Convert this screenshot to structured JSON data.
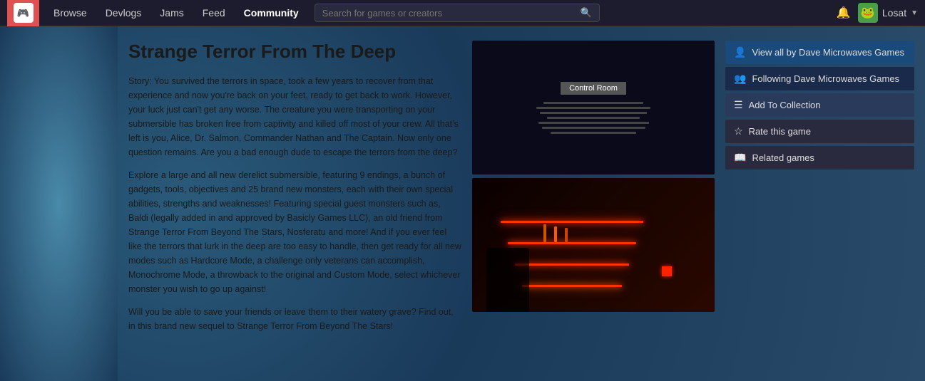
{
  "header": {
    "logo_emoji": "🎮",
    "nav": [
      {
        "label": "Browse",
        "active": false
      },
      {
        "label": "Devlogs",
        "active": false
      },
      {
        "label": "Jams",
        "active": false
      },
      {
        "label": "Feed",
        "active": false
      },
      {
        "label": "Community",
        "active": true
      }
    ],
    "search_placeholder": "Search for games or creators",
    "username": "Losat",
    "avatar_emoji": "🐸"
  },
  "game": {
    "title": "Strange Terror From The Deep",
    "description_1": "Story: You survived the terrors in space, took a few years to recover from that experience and now you're back on your feet, ready to get back to work. However, your luck just can't get any worse. The creature you were transporting on your submersible has broken free from captivity and killed off most of your crew. All that's left is you, Alice, Dr. Salmon, Commander Nathan and The Captain. Now only one question remains. Are you a bad enough dude to escape the terrors from the deep?",
    "description_2": "Explore a large and all new derelict submersible, featuring 9 endings, a bunch of gadgets, tools, objectives and 25 brand new monsters, each with their own special abilities, strengths and weaknesses! Featuring special guest monsters such as, Baldi (legally added in and approved by Basicly Games LLC), an old friend from Strange Terror From Beyond The Stars, Nosferatu and more! And if you ever feel like the terrors that lurk in the deep are too easy to handle, then get ready for all new modes such as Hardcore Mode, a challenge only veterans can accomplish, Monochrome Mode, a throwback to the original and Custom Mode, select whichever monster you wish to go up against!",
    "description_3": "Will you be able to save your friends or leave them to their watery grave? Find out, in this brand new sequel to Strange Terror From Beyond The Stars!"
  },
  "sidebar": {
    "view_all_label": "View all by Dave Microwaves Games",
    "following_label": "Following Dave Microwaves Games",
    "add_collection_label": "Add To Collection",
    "rate_label": "Rate this game",
    "related_label": "Related games"
  },
  "screenshots": {
    "control_room_label": "Control Room"
  }
}
